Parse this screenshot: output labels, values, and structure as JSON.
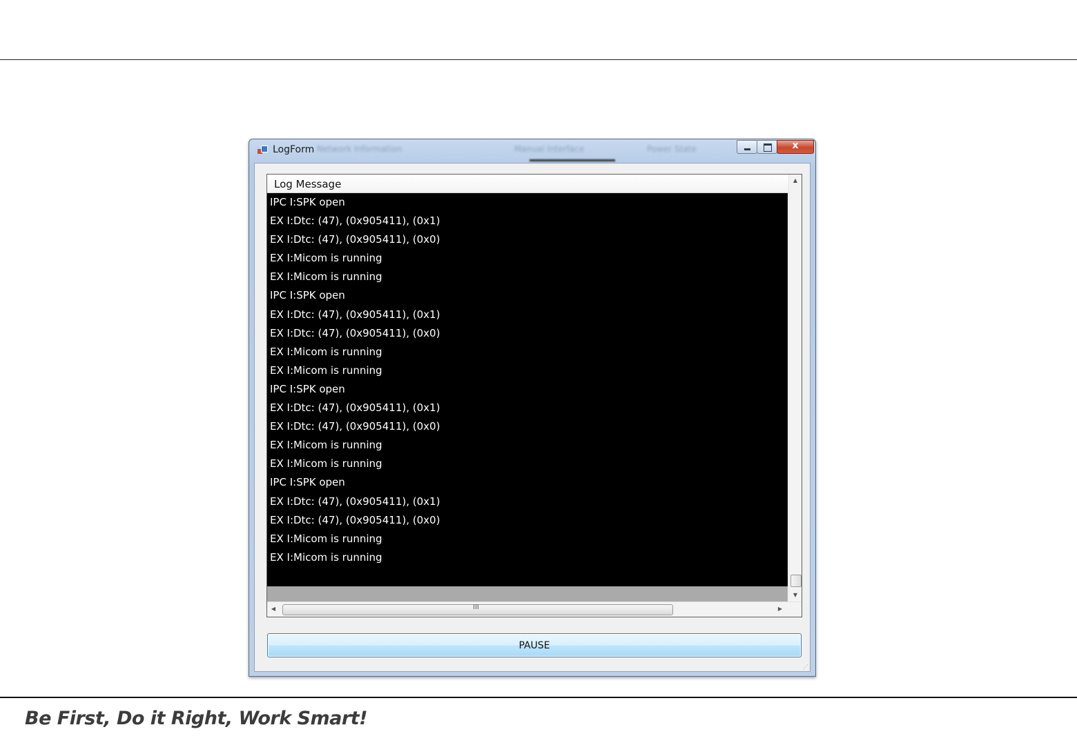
{
  "window": {
    "title": "LogForm",
    "ghost_tabs": [
      "Network Information",
      "Manual Interface",
      "Power State"
    ],
    "controls": {
      "minimize": "",
      "maximize": "",
      "close": "x"
    }
  },
  "log_view": {
    "column_header": "Log Message",
    "lines": [
      "IPC I:SPK open",
      "EX I:Dtc: (47), (0x905411), (0x1)",
      "EX I:Dtc: (47), (0x905411), (0x0)",
      "EX I:Micom is running",
      "EX I:Micom is running",
      "IPC I:SPK open",
      "EX I:Dtc: (47), (0x905411), (0x1)",
      "EX I:Dtc: (47), (0x905411), (0x0)",
      "EX I:Micom is running",
      "EX I:Micom is running",
      "IPC I:SPK open",
      "EX I:Dtc: (47), (0x905411), (0x1)",
      "EX I:Dtc: (47), (0x905411), (0x0)",
      "EX I:Micom is running",
      "EX I:Micom is running",
      "IPC I:SPK open",
      "EX I:Dtc: (47), (0x905411), (0x1)",
      "EX I:Dtc: (47), (0x905411), (0x0)",
      "EX I:Micom is running",
      "EX I:Micom is running"
    ],
    "hscroll_grip": "III"
  },
  "pause_button": {
    "label": "PAUSE"
  },
  "footer": {
    "slogan": "Be First, Do it Right, Work Smart!"
  },
  "colors": {
    "log_background": "#000000",
    "log_text": "#ffffff",
    "button_border": "#3c7fb1"
  }
}
